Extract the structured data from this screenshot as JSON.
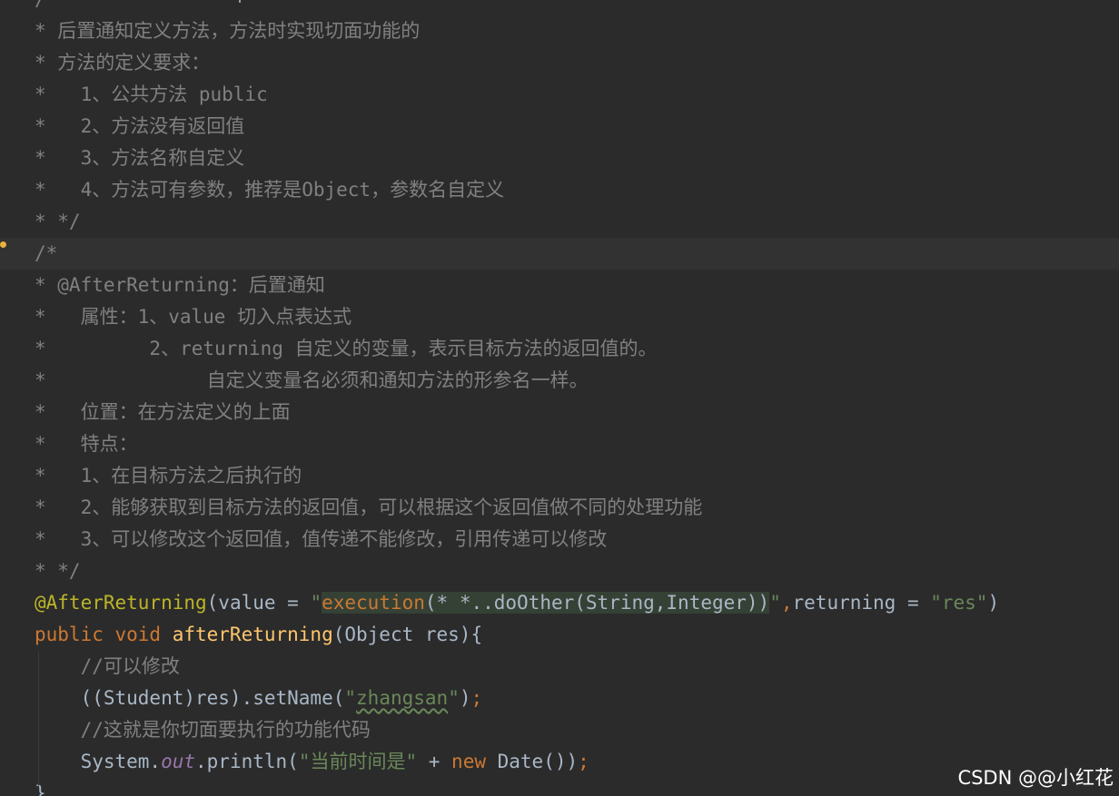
{
  "colors": {
    "background": "#2b2b2b",
    "current_line": "#323232",
    "comment": "#808080",
    "annotation": "#bbb529",
    "keyword": "#cc7832",
    "method_decl": "#ffc66d",
    "string": "#6a8759",
    "plain": "#a9b7c6",
    "static_field": "#9876aa",
    "injected_bg": "#364135"
  },
  "editor": {
    "lines": [
      {
        "segments": [
          {
            "text": "/",
            "color": "#808080"
          }
        ]
      },
      {
        "segments": [
          {
            "text": "* 后置通知定义方法，方法时实现切面功能的",
            "color": "#808080"
          }
        ]
      },
      {
        "segments": [
          {
            "text": "* 方法的定义要求：",
            "color": "#808080"
          }
        ]
      },
      {
        "segments": [
          {
            "text": "*   1、公共方法 public",
            "color": "#808080"
          }
        ]
      },
      {
        "segments": [
          {
            "text": "*   2、方法没有返回值",
            "color": "#808080"
          }
        ]
      },
      {
        "segments": [
          {
            "text": "*   3、方法名称自定义",
            "color": "#808080"
          }
        ]
      },
      {
        "segments": [
          {
            "text": "*   4、方法可有参数，推荐是Object，参数名自定义",
            "color": "#808080"
          }
        ]
      },
      {
        "segments": [
          {
            "text": "* */",
            "color": "#808080"
          }
        ]
      },
      {
        "current": true,
        "segments": [
          {
            "text": "/*",
            "color": "#808080"
          }
        ]
      },
      {
        "segments": [
          {
            "text": "* @AfterReturning：后置通知",
            "color": "#808080"
          }
        ]
      },
      {
        "segments": [
          {
            "text": "*   属性：1、value 切入点表达式",
            "color": "#808080"
          }
        ]
      },
      {
        "segments": [
          {
            "text": "*         2、returning 自定义的变量，表示目标方法的返回值的。",
            "color": "#808080"
          }
        ]
      },
      {
        "segments": [
          {
            "text": "*              自定义变量名必须和通知方法的形参名一样。",
            "color": "#808080"
          }
        ]
      },
      {
        "segments": [
          {
            "text": "*   位置：在方法定义的上面",
            "color": "#808080"
          }
        ]
      },
      {
        "segments": [
          {
            "text": "*   特点：",
            "color": "#808080"
          }
        ]
      },
      {
        "segments": [
          {
            "text": "*   1、在目标方法之后执行的",
            "color": "#808080"
          }
        ]
      },
      {
        "segments": [
          {
            "text": "*   2、能够获取到目标方法的返回值，可以根据这个返回值做不同的处理功能",
            "color": "#808080"
          }
        ]
      },
      {
        "segments": [
          {
            "text": "*   3、可以修改这个返回值，值传递不能修改，引用传递可以修改",
            "color": "#808080"
          }
        ]
      },
      {
        "segments": [
          {
            "text": "* */",
            "color": "#808080"
          }
        ]
      },
      {
        "segments": [
          {
            "text": "@AfterReturning",
            "color": "#bbb529"
          },
          {
            "text": "(value = ",
            "color": "#a9b7c6"
          },
          {
            "text": "\"",
            "color": "#6a8759"
          },
          {
            "text": "execution",
            "color": "#cc7832",
            "bg": "#364135"
          },
          {
            "text": "(* *..doOther(String,Integer))",
            "color": "#a9b7c6",
            "bg": "#364135"
          },
          {
            "text": "\"",
            "color": "#6a8759"
          },
          {
            "text": ",",
            "color": "#cc7832"
          },
          {
            "text": "returning = ",
            "color": "#a9b7c6"
          },
          {
            "text": "\"res\"",
            "color": "#6a8759"
          },
          {
            "text": ")",
            "color": "#a9b7c6"
          }
        ]
      },
      {
        "segments": [
          {
            "text": "public void ",
            "color": "#cc7832"
          },
          {
            "text": "afterReturning",
            "color": "#ffc66d"
          },
          {
            "text": "(Object res){",
            "color": "#a9b7c6"
          }
        ]
      },
      {
        "segments": [
          {
            "text": "    //可以修改",
            "color": "#808080"
          }
        ]
      },
      {
        "segments": [
          {
            "text": "    ((Student)res).setName(",
            "color": "#a9b7c6"
          },
          {
            "text": "\"",
            "color": "#6a8759"
          },
          {
            "text": "zhangsan",
            "color": "#6a8759",
            "squiggle": true
          },
          {
            "text": "\"",
            "color": "#6a8759"
          },
          {
            "text": ")",
            "color": "#a9b7c6"
          },
          {
            "text": ";",
            "color": "#cc7832"
          }
        ]
      },
      {
        "segments": [
          {
            "text": "    //这就是你切面要执行的功能代码",
            "color": "#808080"
          }
        ]
      },
      {
        "segments": [
          {
            "text": "    System.",
            "color": "#a9b7c6"
          },
          {
            "text": "out",
            "color": "#9876aa",
            "italic": true
          },
          {
            "text": ".println(",
            "color": "#a9b7c6"
          },
          {
            "text": "\"当前时间是\"",
            "color": "#6a8759"
          },
          {
            "text": " + ",
            "color": "#a9b7c6"
          },
          {
            "text": "new ",
            "color": "#cc7832"
          },
          {
            "text": "Date())",
            "color": "#a9b7c6"
          },
          {
            "text": ";",
            "color": "#cc7832"
          }
        ]
      },
      {
        "segments": [
          {
            "text": "}",
            "color": "#a9b7c6"
          }
        ]
      }
    ]
  },
  "watermark": "CSDN @@小红花"
}
